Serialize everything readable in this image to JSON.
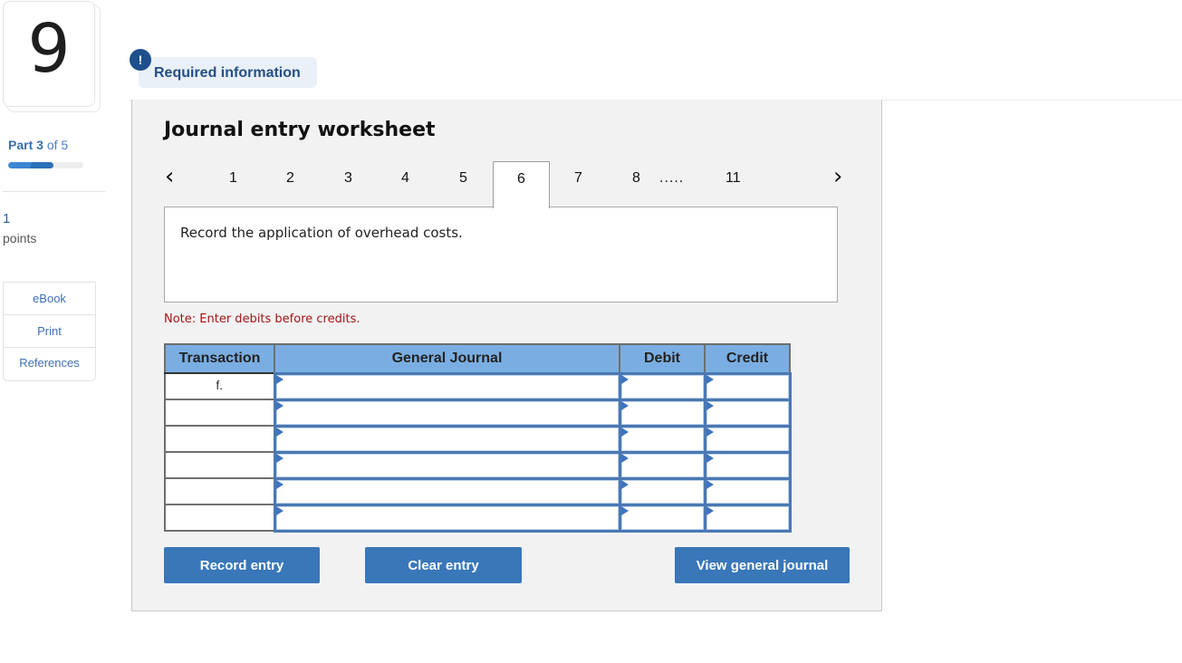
{
  "question": {
    "number": "9",
    "part_label": "Part",
    "part_current": "3",
    "part_of": "of 5",
    "progress_fraction": 0.6,
    "points_value": "1",
    "points_label": "points"
  },
  "sidebar": {
    "links": [
      {
        "label": "eBook"
      },
      {
        "label": "Print"
      },
      {
        "label": "References"
      }
    ]
  },
  "required_info": {
    "icon": "!",
    "label": "Required information"
  },
  "worksheet": {
    "title": "Journal entry worksheet",
    "pager": {
      "prev_icon": "‹",
      "next_icon": "›",
      "pages": [
        "1",
        "2",
        "3",
        "4",
        "5",
        "6",
        "7",
        "8"
      ],
      "active": "6",
      "ellipsis": ".....",
      "last": "11"
    },
    "instruction": "Record the application of overhead costs.",
    "note": "Note: Enter debits before credits.",
    "table": {
      "headers": [
        "Transaction",
        "General Journal",
        "Debit",
        "Credit"
      ],
      "rows": [
        {
          "transaction": "f.",
          "account": "",
          "debit": "",
          "credit": ""
        },
        {
          "transaction": "",
          "account": "",
          "debit": "",
          "credit": ""
        },
        {
          "transaction": "",
          "account": "",
          "debit": "",
          "credit": ""
        },
        {
          "transaction": "",
          "account": "",
          "debit": "",
          "credit": ""
        },
        {
          "transaction": "",
          "account": "",
          "debit": "",
          "credit": ""
        },
        {
          "transaction": "",
          "account": "",
          "debit": "",
          "credit": ""
        }
      ]
    },
    "buttons": {
      "record": "Record entry",
      "clear": "Clear entry",
      "view": "View general journal"
    }
  },
  "colors": {
    "accent": "#3977b9",
    "table_header": "#7aaee2",
    "note": "#a31515",
    "required_bg": "#e9f0f8"
  }
}
